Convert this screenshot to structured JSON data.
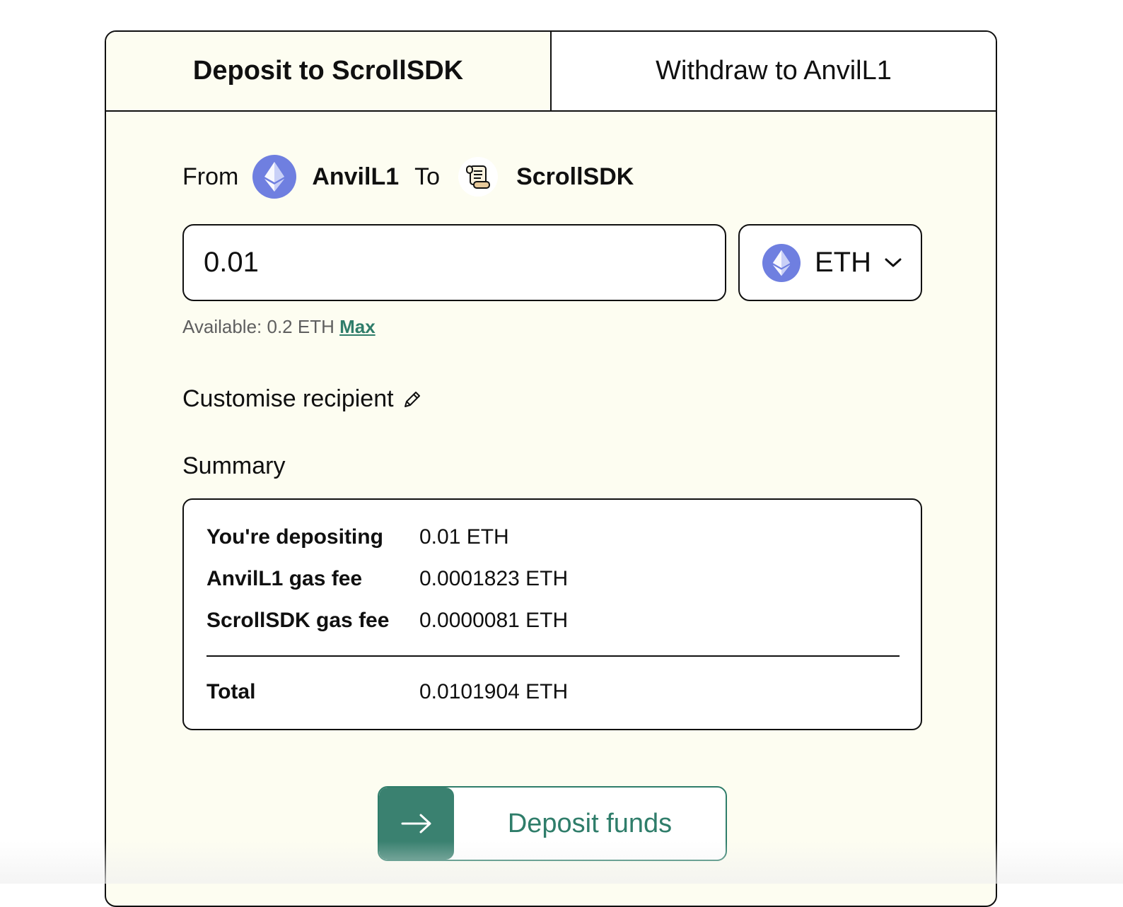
{
  "tabs": [
    {
      "label": "Deposit to ScrollSDK",
      "active": true
    },
    {
      "label": "Withdraw to AnvilL1",
      "active": false
    }
  ],
  "route": {
    "from_label": "From",
    "from_network": "AnvilL1",
    "to_label": "To",
    "to_network": "ScrollSDK",
    "from_icon": "ethereum-icon",
    "to_icon": "scroll-icon"
  },
  "amount_input": {
    "value": "0.01"
  },
  "token_select": {
    "selected": "ETH",
    "icon": "ethereum-icon"
  },
  "available": {
    "text": "Available: 0.2 ETH",
    "max_label": "Max"
  },
  "customise": {
    "label": "Customise recipient",
    "icon": "pencil-icon"
  },
  "summary": {
    "title": "Summary",
    "rows": [
      {
        "label": "You're depositing",
        "value": "0.01 ETH"
      },
      {
        "label": "AnvilL1 gas fee",
        "value": "0.0001823 ETH"
      },
      {
        "label": "ScrollSDK gas fee",
        "value": "0.0000081 ETH"
      }
    ],
    "total": {
      "label": "Total",
      "value": "0.0101904 ETH"
    }
  },
  "deposit_button": {
    "label": "Deposit funds",
    "icon": "arrow-right-icon"
  },
  "colors": {
    "accent": "#2f7d6a",
    "card_bg": "#fdfdf1",
    "eth": "#6f7fe0"
  }
}
